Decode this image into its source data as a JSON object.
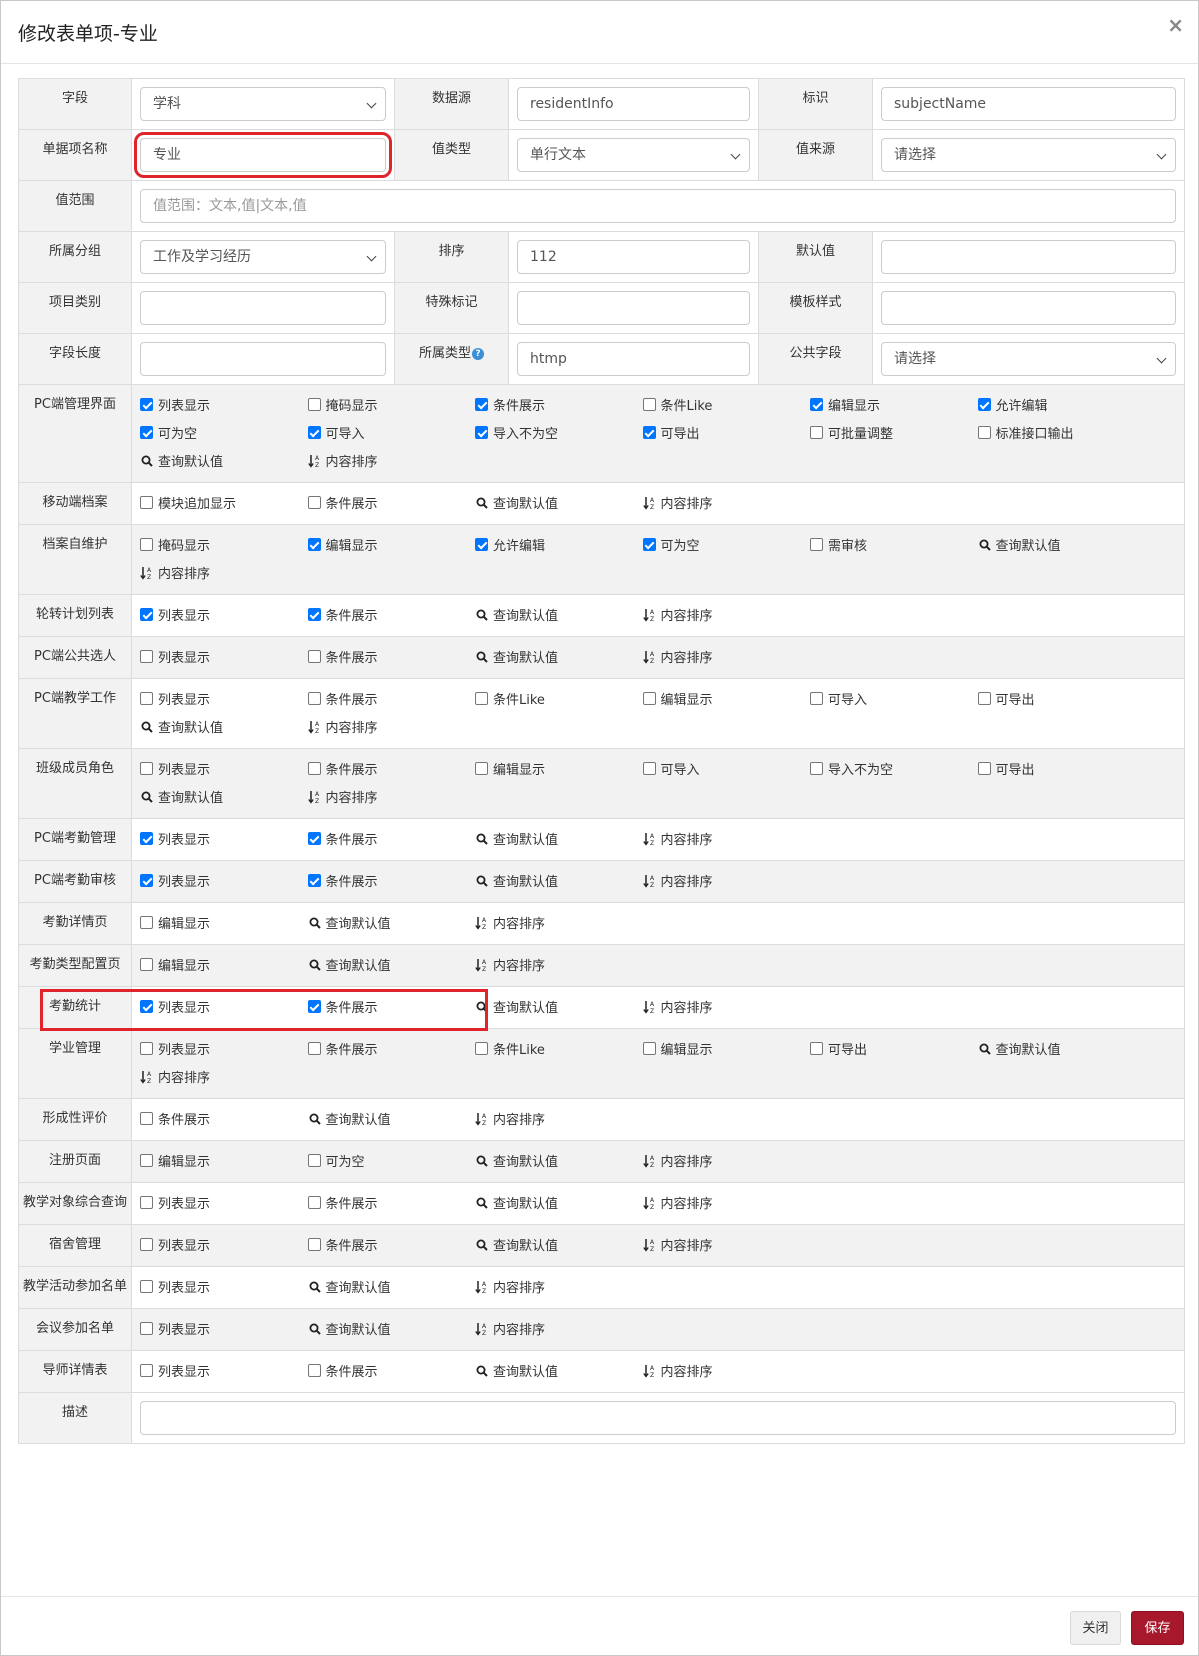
{
  "title": "修改表单项-专业",
  "close_symbol": "×",
  "fields": {
    "field_label": "字段",
    "field_value": "学科",
    "datasource_label": "数据源",
    "datasource_value": "residentInfo",
    "ident_label": "标识",
    "ident_value": "subjectName",
    "name_label": "单据项名称",
    "name_value": "专业",
    "valtype_label": "值类型",
    "valtype_value": "单行文本",
    "valsrc_label": "值来源",
    "valsrc_value": "请选择",
    "range_label": "值范围",
    "range_placeholder": "值范围：文本,值|文本,值",
    "group_label": "所属分组",
    "group_value": "工作及学习经历",
    "sort_label": "排序",
    "sort_value": "112",
    "default_label": "默认值",
    "default_value": "",
    "category_label": "项目类别",
    "category_value": "",
    "special_label": "特殊标记",
    "special_value": "",
    "template_label": "模板样式",
    "template_value": "",
    "length_label": "字段长度",
    "length_value": "",
    "owntype_label": "所属类型",
    "owntype_value": "htmp",
    "public_label": "公共字段",
    "public_value": "请选择",
    "desc_label": "描述",
    "desc_value": ""
  },
  "sections": [
    {
      "label": "PC端管理界面",
      "options": [
        {
          "type": "cb",
          "text": "列表显示",
          "checked": true
        },
        {
          "type": "cb",
          "text": "掩码显示",
          "checked": false
        },
        {
          "type": "cb",
          "text": "条件展示",
          "checked": true
        },
        {
          "type": "cb",
          "text": "条件Like",
          "checked": false
        },
        {
          "type": "cb",
          "text": "编辑显示",
          "checked": true
        },
        {
          "type": "cb",
          "text": "允许编辑",
          "checked": true
        },
        {
          "type": "cb",
          "text": "可为空",
          "checked": true
        },
        {
          "type": "cb",
          "text": "可导入",
          "checked": true
        },
        {
          "type": "cb",
          "text": "导入不为空",
          "checked": true
        },
        {
          "type": "cb",
          "text": "可导出",
          "checked": true
        },
        {
          "type": "cb",
          "text": "可批量调整",
          "checked": false
        },
        {
          "type": "cb",
          "text": "标准接口输出",
          "checked": false
        },
        {
          "type": "search",
          "text": "查询默认值"
        },
        {
          "type": "sort",
          "text": "内容排序"
        }
      ]
    },
    {
      "label": "移动端档案",
      "options": [
        {
          "type": "cb",
          "text": "模块追加显示",
          "checked": false
        },
        {
          "type": "cb",
          "text": "条件展示",
          "checked": false
        },
        {
          "type": "search",
          "text": "查询默认值"
        },
        {
          "type": "sort",
          "text": "内容排序"
        }
      ]
    },
    {
      "label": "档案自维护",
      "options": [
        {
          "type": "cb",
          "text": "掩码显示",
          "checked": false
        },
        {
          "type": "cb",
          "text": "编辑显示",
          "checked": true
        },
        {
          "type": "cb",
          "text": "允许编辑",
          "checked": true
        },
        {
          "type": "cb",
          "text": "可为空",
          "checked": true
        },
        {
          "type": "cb",
          "text": "需审核",
          "checked": false
        },
        {
          "type": "search",
          "text": "查询默认值"
        },
        {
          "type": "sort",
          "text": "内容排序"
        }
      ]
    },
    {
      "label": "轮转计划列表",
      "options": [
        {
          "type": "cb",
          "text": "列表显示",
          "checked": true
        },
        {
          "type": "cb",
          "text": "条件展示",
          "checked": true
        },
        {
          "type": "search",
          "text": "查询默认值"
        },
        {
          "type": "sort",
          "text": "内容排序"
        }
      ]
    },
    {
      "label": "PC端公共选人",
      "options": [
        {
          "type": "cb",
          "text": "列表显示",
          "checked": false
        },
        {
          "type": "cb",
          "text": "条件展示",
          "checked": false
        },
        {
          "type": "search",
          "text": "查询默认值"
        },
        {
          "type": "sort",
          "text": "内容排序"
        }
      ]
    },
    {
      "label": "PC端教学工作",
      "options": [
        {
          "type": "cb",
          "text": "列表显示",
          "checked": false
        },
        {
          "type": "cb",
          "text": "条件展示",
          "checked": false
        },
        {
          "type": "cb",
          "text": "条件Like",
          "checked": false
        },
        {
          "type": "cb",
          "text": "编辑显示",
          "checked": false
        },
        {
          "type": "cb",
          "text": "可导入",
          "checked": false
        },
        {
          "type": "cb",
          "text": "可导出",
          "checked": false
        },
        {
          "type": "search",
          "text": "查询默认值"
        },
        {
          "type": "sort",
          "text": "内容排序"
        }
      ]
    },
    {
      "label": "班级成员角色",
      "options": [
        {
          "type": "cb",
          "text": "列表显示",
          "checked": false
        },
        {
          "type": "cb",
          "text": "条件展示",
          "checked": false
        },
        {
          "type": "cb",
          "text": "编辑显示",
          "checked": false
        },
        {
          "type": "cb",
          "text": "可导入",
          "checked": false
        },
        {
          "type": "cb",
          "text": "导入不为空",
          "checked": false
        },
        {
          "type": "cb",
          "text": "可导出",
          "checked": false
        },
        {
          "type": "search",
          "text": "查询默认值"
        },
        {
          "type": "sort",
          "text": "内容排序"
        }
      ]
    },
    {
      "label": "PC端考勤管理",
      "options": [
        {
          "type": "cb",
          "text": "列表显示",
          "checked": true
        },
        {
          "type": "cb",
          "text": "条件展示",
          "checked": true
        },
        {
          "type": "search",
          "text": "查询默认值"
        },
        {
          "type": "sort",
          "text": "内容排序"
        }
      ]
    },
    {
      "label": "PC端考勤审核",
      "options": [
        {
          "type": "cb",
          "text": "列表显示",
          "checked": true
        },
        {
          "type": "cb",
          "text": "条件展示",
          "checked": true
        },
        {
          "type": "search",
          "text": "查询默认值"
        },
        {
          "type": "sort",
          "text": "内容排序"
        }
      ]
    },
    {
      "label": "考勤详情页",
      "options": [
        {
          "type": "cb",
          "text": "编辑显示",
          "checked": false
        },
        {
          "type": "search",
          "text": "查询默认值"
        },
        {
          "type": "sort",
          "text": "内容排序"
        }
      ]
    },
    {
      "label": "考勤类型配置页",
      "options": [
        {
          "type": "cb",
          "text": "编辑显示",
          "checked": false
        },
        {
          "type": "search",
          "text": "查询默认值"
        },
        {
          "type": "sort",
          "text": "内容排序"
        }
      ]
    },
    {
      "label": "考勤统计",
      "highlight": true,
      "options": [
        {
          "type": "cb",
          "text": "列表显示",
          "checked": true
        },
        {
          "type": "cb",
          "text": "条件展示",
          "checked": true
        },
        {
          "type": "search",
          "text": "查询默认值"
        },
        {
          "type": "sort",
          "text": "内容排序"
        }
      ]
    },
    {
      "label": "学业管理",
      "options": [
        {
          "type": "cb",
          "text": "列表显示",
          "checked": false
        },
        {
          "type": "cb",
          "text": "条件展示",
          "checked": false
        },
        {
          "type": "cb",
          "text": "条件Like",
          "checked": false
        },
        {
          "type": "cb",
          "text": "编辑显示",
          "checked": false
        },
        {
          "type": "cb",
          "text": "可导出",
          "checked": false
        },
        {
          "type": "search",
          "text": "查询默认值"
        },
        {
          "type": "sort",
          "text": "内容排序"
        }
      ]
    },
    {
      "label": "形成性评价",
      "options": [
        {
          "type": "cb",
          "text": "条件展示",
          "checked": false
        },
        {
          "type": "search",
          "text": "查询默认值"
        },
        {
          "type": "sort",
          "text": "内容排序"
        }
      ]
    },
    {
      "label": "注册页面",
      "options": [
        {
          "type": "cb",
          "text": "编辑显示",
          "checked": false
        },
        {
          "type": "cb",
          "text": "可为空",
          "checked": false
        },
        {
          "type": "search",
          "text": "查询默认值"
        },
        {
          "type": "sort",
          "text": "内容排序"
        }
      ]
    },
    {
      "label": "教学对象综合查询",
      "options": [
        {
          "type": "cb",
          "text": "列表显示",
          "checked": false
        },
        {
          "type": "cb",
          "text": "条件展示",
          "checked": false
        },
        {
          "type": "search",
          "text": "查询默认值"
        },
        {
          "type": "sort",
          "text": "内容排序"
        }
      ]
    },
    {
      "label": "宿舍管理",
      "options": [
        {
          "type": "cb",
          "text": "列表显示",
          "checked": false
        },
        {
          "type": "cb",
          "text": "条件展示",
          "checked": false
        },
        {
          "type": "search",
          "text": "查询默认值"
        },
        {
          "type": "sort",
          "text": "内容排序"
        }
      ]
    },
    {
      "label": "教学活动参加名单",
      "options": [
        {
          "type": "cb",
          "text": "列表显示",
          "checked": false
        },
        {
          "type": "search",
          "text": "查询默认值"
        },
        {
          "type": "sort",
          "text": "内容排序"
        }
      ]
    },
    {
      "label": "会议参加名单",
      "options": [
        {
          "type": "cb",
          "text": "列表显示",
          "checked": false
        },
        {
          "type": "search",
          "text": "查询默认值"
        },
        {
          "type": "sort",
          "text": "内容排序"
        }
      ]
    },
    {
      "label": "导师详情表",
      "options": [
        {
          "type": "cb",
          "text": "列表显示",
          "checked": false
        },
        {
          "type": "cb",
          "text": "条件展示",
          "checked": false
        },
        {
          "type": "search",
          "text": "查询默认值"
        },
        {
          "type": "sort",
          "text": "内容排序"
        }
      ]
    }
  ],
  "footer": {
    "close_label": "关闭",
    "save_label": "保存"
  },
  "colors": {
    "checked": "#0075ff",
    "highlight": "#e0242b",
    "save_button": "#a8182c"
  }
}
